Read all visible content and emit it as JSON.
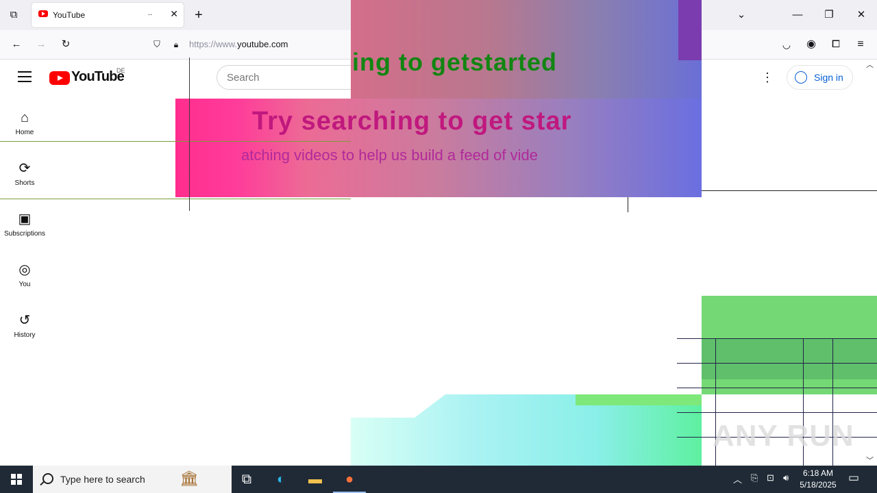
{
  "browser": {
    "tab": {
      "title": "YouTube",
      "ellipsis": "..",
      "close": "✕"
    },
    "new_tab": "+",
    "url": {
      "prefix": "https://www.",
      "domain": "youtube.com"
    },
    "window": {
      "list_all": "⌄",
      "minimize": "—",
      "restore": "❐",
      "close": "✕"
    }
  },
  "masthead": {
    "logo_text": "YouTube",
    "country_code": "DE",
    "search_placeholder": "Search",
    "more": "⋮",
    "sign_in": "Sign in"
  },
  "sidebar": {
    "items": [
      {
        "label": "Home",
        "icon": "home-icon"
      },
      {
        "label": "Shorts",
        "icon": "shorts-icon"
      },
      {
        "label": "Subscriptions",
        "icon": "subscriptions-icon"
      },
      {
        "label": "You",
        "icon": "you-icon"
      },
      {
        "label": "History",
        "icon": "history-icon"
      }
    ]
  },
  "feed_prompt": {
    "title_fragment_top": "ing to getstarted",
    "title_fragment": "Try searching to get star",
    "subtitle_fragment": "atching videos to help us build a feed of vide"
  },
  "watermark": "ANY RUN",
  "taskbar": {
    "search_placeholder": "Type here to search",
    "time": "6:18 AM",
    "date": "5/18/2025"
  }
}
